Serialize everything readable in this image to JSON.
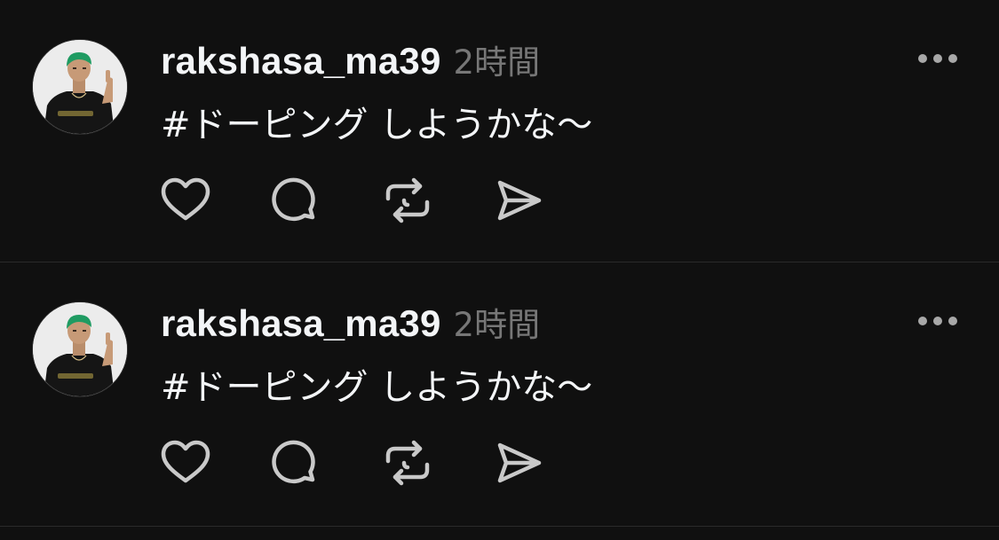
{
  "colors": {
    "background": "#101010",
    "text_primary": "#f3f5f7",
    "text_secondary": "#777777",
    "icon": "#c9c9c9",
    "divider": "#2a2a2a"
  },
  "posts": [
    {
      "username": "rakshasa_ma39",
      "time": "2時間",
      "caption": "#ドーピング しようかな〜",
      "avatar_icon": "profile-photo",
      "more_icon": "more-horizontal-icon",
      "actions": [
        {
          "icon": "heart-icon"
        },
        {
          "icon": "comment-icon"
        },
        {
          "icon": "repost-icon"
        },
        {
          "icon": "share-icon"
        }
      ]
    },
    {
      "username": "rakshasa_ma39",
      "time": "2時間",
      "caption": "#ドーピング しようかな〜",
      "avatar_icon": "profile-photo",
      "more_icon": "more-horizontal-icon",
      "actions": [
        {
          "icon": "heart-icon"
        },
        {
          "icon": "comment-icon"
        },
        {
          "icon": "repost-icon"
        },
        {
          "icon": "share-icon"
        }
      ]
    }
  ]
}
